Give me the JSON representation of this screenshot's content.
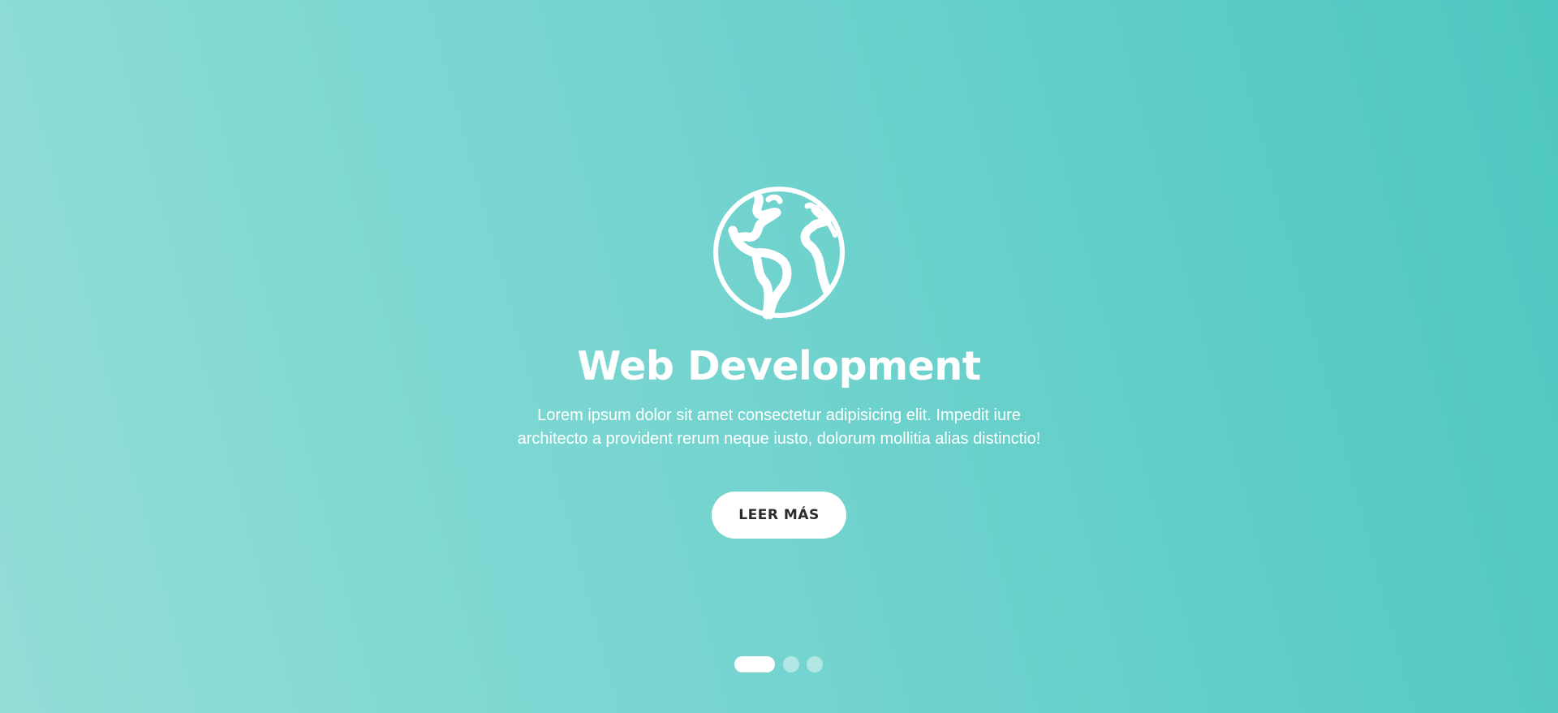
{
  "colors": {
    "gradient_start": "#93ddd8",
    "gradient_end": "#4ec8c0",
    "text": "#ffffff",
    "button_bg": "#ffffff",
    "button_text": "#2b2b2b"
  },
  "slider": {
    "icon": "globe-icon",
    "title": "Web Development",
    "description": "Lorem ipsum dolor sit amet consectetur adipisicing elit. Impedit iure architecto a provident rerum neque iusto, dolorum mollitia alias distinctio!",
    "button_label": "LEER MÁS",
    "current_slide": 1,
    "total_slides": 3
  }
}
